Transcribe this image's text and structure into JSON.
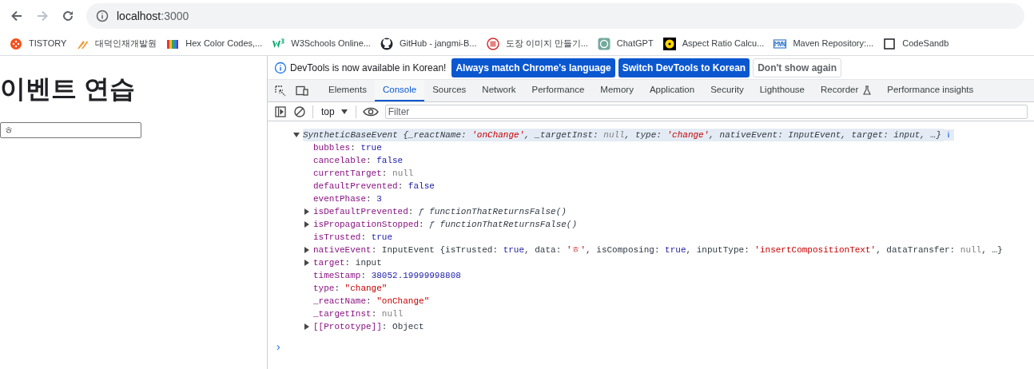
{
  "address_bar": {
    "url_host": "localhost",
    "url_port": ":3000"
  },
  "bookmarks": [
    "TISTORY",
    "대덕인재개발원",
    "Hex Color Codes,...",
    "W3Schools Online...",
    "GitHub - jangmi-B...",
    "도장 이미지 만들기...",
    "ChatGPT",
    "Aspect Ratio Calcu...",
    "Maven Repository:...",
    "CodeSandb"
  ],
  "page": {
    "heading": "이벤트 연습",
    "input_value": "ㅎ"
  },
  "devtools": {
    "infobar": {
      "message": "DevTools is now available in Korean!",
      "buttons": [
        {
          "label": "Always match Chrome's language",
          "primary": true
        },
        {
          "label": "Switch DevTools to Korean",
          "primary": true
        },
        {
          "label": "Don't show again",
          "primary": false
        }
      ]
    },
    "tabs": [
      {
        "label": "Elements",
        "selected": false
      },
      {
        "label": "Console",
        "selected": true
      },
      {
        "label": "Sources",
        "selected": false
      },
      {
        "label": "Network",
        "selected": false
      },
      {
        "label": "Performance",
        "selected": false
      },
      {
        "label": "Memory",
        "selected": false
      },
      {
        "label": "Application",
        "selected": false
      },
      {
        "label": "Security",
        "selected": false
      },
      {
        "label": "Lighthouse",
        "selected": false
      },
      {
        "label": "Recorder",
        "selected": false
      },
      {
        "label": "Performance insights",
        "selected": false
      }
    ],
    "context": "top",
    "filter_placeholder": "Filter",
    "lines": [
      {
        "kind": "summary",
        "expanded": true,
        "tokens": [
          {
            "kind": "name",
            "text": "SyntheticBaseEvent "
          },
          {
            "kind": "plain",
            "text": "{_reactName: "
          },
          {
            "kind": "str",
            "text": "'onChange'"
          },
          {
            "kind": "plain",
            "text": ", _targetInst: "
          },
          {
            "kind": "null",
            "text": "null"
          },
          {
            "kind": "plain",
            "text": ", type: "
          },
          {
            "kind": "str",
            "text": "'change'"
          },
          {
            "kind": "plain",
            "text": ", nativeEvent: InputEvent, target: input, …}"
          }
        ]
      },
      {
        "kind": "leaf",
        "tokens": [
          {
            "kind": "key",
            "text": "bubbles"
          },
          {
            "kind": "plain",
            "text": ": "
          },
          {
            "kind": "num",
            "text": "true"
          }
        ]
      },
      {
        "kind": "leaf",
        "tokens": [
          {
            "kind": "key",
            "text": "cancelable"
          },
          {
            "kind": "plain",
            "text": ": "
          },
          {
            "kind": "num",
            "text": "false"
          }
        ]
      },
      {
        "kind": "leaf",
        "tokens": [
          {
            "kind": "key",
            "text": "currentTarget"
          },
          {
            "kind": "plain",
            "text": ": "
          },
          {
            "kind": "null",
            "text": "null"
          }
        ]
      },
      {
        "kind": "leaf",
        "tokens": [
          {
            "kind": "key",
            "text": "defaultPrevented"
          },
          {
            "kind": "plain",
            "text": ": "
          },
          {
            "kind": "num",
            "text": "false"
          }
        ]
      },
      {
        "kind": "leaf",
        "tokens": [
          {
            "kind": "key",
            "text": "eventPhase"
          },
          {
            "kind": "plain",
            "text": ": "
          },
          {
            "kind": "num",
            "text": "3"
          }
        ]
      },
      {
        "kind": "node",
        "expanded": false,
        "tokens": [
          {
            "kind": "key",
            "text": "isDefaultPrevented"
          },
          {
            "kind": "plain",
            "text": ": "
          },
          {
            "kind": "fn",
            "text": "ƒ functionThatReturnsFalse()"
          }
        ]
      },
      {
        "kind": "node",
        "expanded": false,
        "tokens": [
          {
            "kind": "key",
            "text": "isPropagationStopped"
          },
          {
            "kind": "plain",
            "text": ": "
          },
          {
            "kind": "fn",
            "text": "ƒ functionThatReturnsFalse()"
          }
        ]
      },
      {
        "kind": "leaf",
        "tokens": [
          {
            "kind": "key",
            "text": "isTrusted"
          },
          {
            "kind": "plain",
            "text": ": "
          },
          {
            "kind": "num",
            "text": "true"
          }
        ]
      },
      {
        "kind": "node",
        "expanded": false,
        "tokens": [
          {
            "kind": "key",
            "text": "nativeEvent"
          },
          {
            "kind": "plain",
            "text": ": InputEvent {isTrusted: "
          },
          {
            "kind": "num",
            "text": "true"
          },
          {
            "kind": "plain",
            "text": ", data: "
          },
          {
            "kind": "str",
            "text": "'ㅎ'"
          },
          {
            "kind": "plain",
            "text": ", isComposing: "
          },
          {
            "kind": "num",
            "text": "true"
          },
          {
            "kind": "plain",
            "text": ", inputType: "
          },
          {
            "kind": "str",
            "text": "'insertCompositionText'"
          },
          {
            "kind": "plain",
            "text": ", dataTransfer: "
          },
          {
            "kind": "null",
            "text": "null"
          },
          {
            "kind": "plain",
            "text": ", …}"
          }
        ]
      },
      {
        "kind": "node",
        "expanded": false,
        "tokens": [
          {
            "kind": "key",
            "text": "target"
          },
          {
            "kind": "plain",
            "text": ": input"
          }
        ]
      },
      {
        "kind": "leaf",
        "tokens": [
          {
            "kind": "key",
            "text": "timeStamp"
          },
          {
            "kind": "plain",
            "text": ": "
          },
          {
            "kind": "num",
            "text": "38052.19999998808"
          }
        ]
      },
      {
        "kind": "leaf",
        "tokens": [
          {
            "kind": "key",
            "text": "type"
          },
          {
            "kind": "plain",
            "text": ": "
          },
          {
            "kind": "str",
            "text": "\"change\""
          }
        ]
      },
      {
        "kind": "leaf",
        "tokens": [
          {
            "kind": "key",
            "text": "_reactName"
          },
          {
            "kind": "plain",
            "text": ": "
          },
          {
            "kind": "str",
            "text": "\"onChange\""
          }
        ]
      },
      {
        "kind": "leaf",
        "tokens": [
          {
            "kind": "key",
            "text": "_targetInst"
          },
          {
            "kind": "plain",
            "text": ": "
          },
          {
            "kind": "null",
            "text": "null"
          }
        ]
      },
      {
        "kind": "node",
        "expanded": false,
        "tokens": [
          {
            "kind": "key",
            "text": "[[Prototype]]"
          },
          {
            "kind": "plain",
            "text": ": Object"
          }
        ]
      }
    ],
    "prompt": "›"
  }
}
